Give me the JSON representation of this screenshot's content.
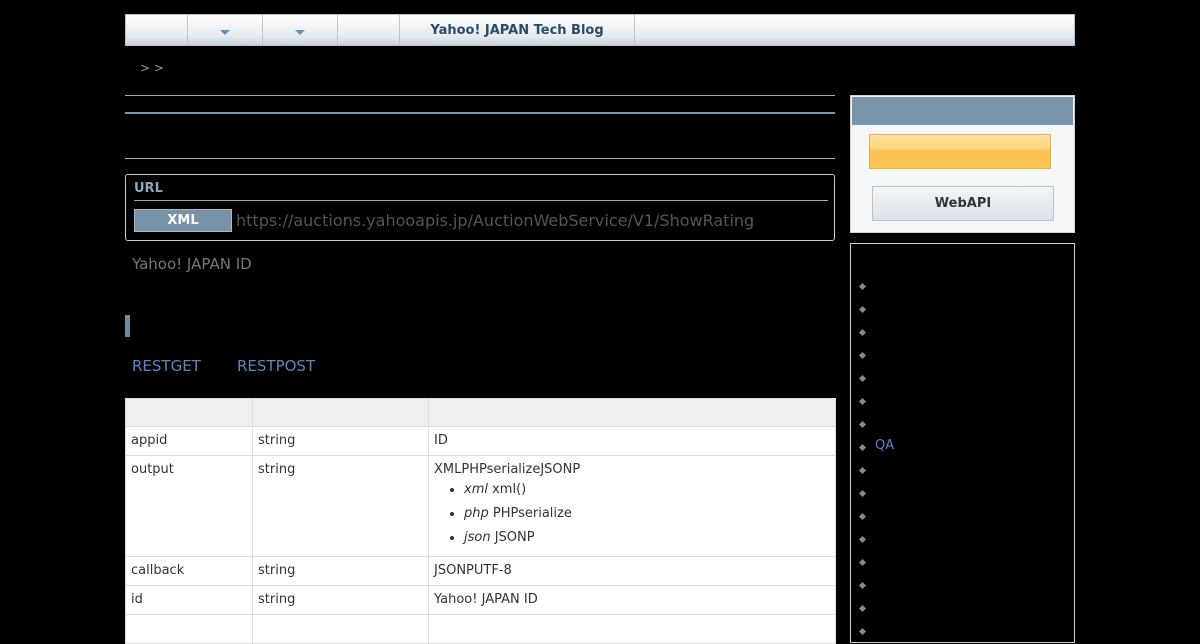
{
  "nav": {
    "title": "Yahoo! JAPAN Tech Blog"
  },
  "breadcrumb": {
    "text": "> >"
  },
  "url_section": {
    "label": "URL",
    "format_badge": "XML",
    "endpoint": "https://auctions.yahooapis.jp/AuctionWebService/V1/ShowRating"
  },
  "id_note": "Yahoo! JAPAN ID",
  "methods": {
    "get": "RESTGET",
    "post": "RESTPOST"
  },
  "params_table": {
    "rows": [
      {
        "name": "appid",
        "type": "string",
        "desc": "ID"
      },
      {
        "name": "output",
        "type": "string",
        "desc": "XMLPHPserializeJSONP",
        "options": [
          {
            "key": "xml",
            "text": "xml()"
          },
          {
            "key": "php",
            "text": "PHPserialize"
          },
          {
            "key": "json",
            "text": "JSONP"
          }
        ]
      },
      {
        "name": "callback",
        "type": "string",
        "desc": "JSONPUTF-8"
      },
      {
        "name": "id",
        "type": "string",
        "desc": "Yahoo! JAPAN ID"
      }
    ]
  },
  "sidebar": {
    "webapi_button": "WebAPI",
    "list_items": [
      "",
      "",
      "",
      "",
      "",
      "",
      "",
      "QA",
      "",
      "",
      "",
      "",
      "",
      "",
      "",
      ""
    ]
  }
}
